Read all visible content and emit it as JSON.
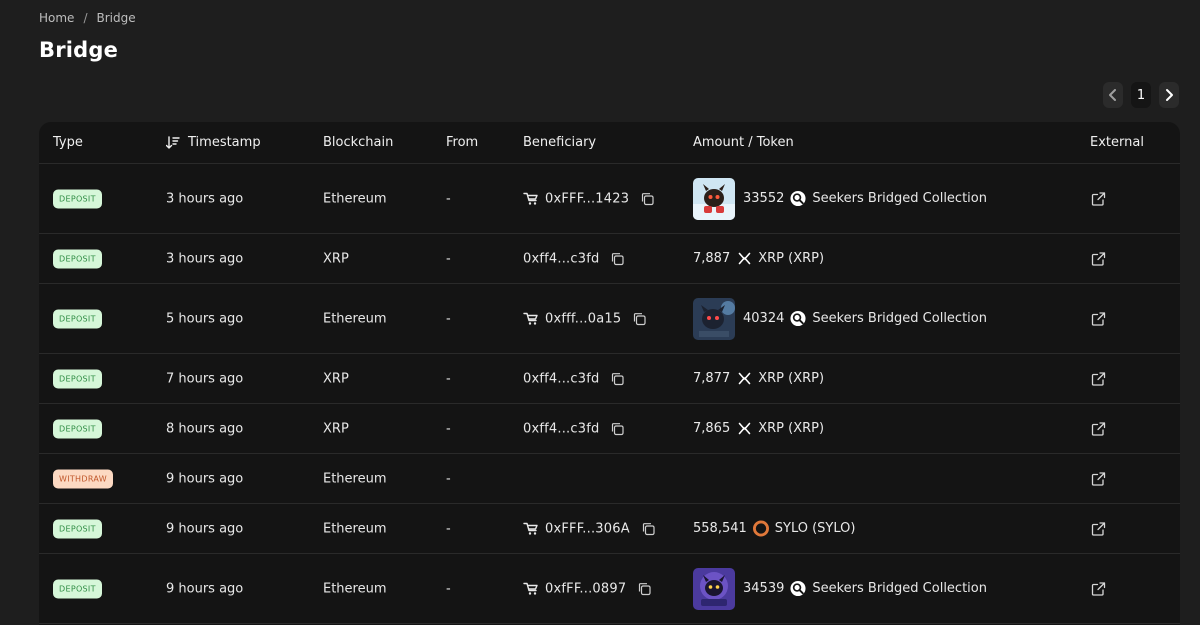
{
  "breadcrumb": {
    "home": "Home",
    "separator": "/",
    "current": "Bridge"
  },
  "page_title": "Bridge",
  "pagination": {
    "current_page": "1"
  },
  "table": {
    "headers": {
      "type": "Type",
      "timestamp": "Timestamp",
      "blockchain": "Blockchain",
      "from": "From",
      "beneficiary": "Beneficiary",
      "amount_token": "Amount / Token",
      "external": "External"
    },
    "rows": [
      {
        "type": "DEPOSIT",
        "time": "3 hours ago",
        "chain": "Ethereum",
        "from": "-",
        "beneficiary": "0xFFF...1423",
        "bridge_icon": true,
        "amount": "33552",
        "token": "Seekers Bridged Collection",
        "token_icon": "seekers-icon",
        "thumb": "nft-1"
      },
      {
        "type": "DEPOSIT",
        "time": "3 hours ago",
        "chain": "XRP",
        "from": "-",
        "beneficiary": "0xff4...c3fd",
        "bridge_icon": false,
        "amount": "7,887",
        "token": "XRP (XRP)",
        "token_icon": "xrp-icon",
        "thumb": null
      },
      {
        "type": "DEPOSIT",
        "time": "5 hours ago",
        "chain": "Ethereum",
        "from": "-",
        "beneficiary": "0xfff...0a15",
        "bridge_icon": true,
        "amount": "40324",
        "token": "Seekers Bridged Collection",
        "token_icon": "seekers-icon",
        "thumb": "nft-2"
      },
      {
        "type": "DEPOSIT",
        "time": "7 hours ago",
        "chain": "XRP",
        "from": "-",
        "beneficiary": "0xff4...c3fd",
        "bridge_icon": false,
        "amount": "7,877",
        "token": "XRP (XRP)",
        "token_icon": "xrp-icon",
        "thumb": null
      },
      {
        "type": "DEPOSIT",
        "time": "8 hours ago",
        "chain": "XRP",
        "from": "-",
        "beneficiary": "0xff4...c3fd",
        "bridge_icon": false,
        "amount": "7,865",
        "token": "XRP (XRP)",
        "token_icon": "xrp-icon",
        "thumb": null
      },
      {
        "type": "WITHDRAW",
        "time": "9 hours ago",
        "chain": "Ethereum",
        "from": "-",
        "beneficiary": "",
        "bridge_icon": false,
        "amount": "",
        "token": "",
        "token_icon": null,
        "thumb": null
      },
      {
        "type": "DEPOSIT",
        "time": "9 hours ago",
        "chain": "Ethereum",
        "from": "-",
        "beneficiary": "0xFFF...306A",
        "bridge_icon": true,
        "amount": "558,541",
        "token": "SYLO (SYLO)",
        "token_icon": "sylo-icon",
        "thumb": null
      },
      {
        "type": "DEPOSIT",
        "time": "9 hours ago",
        "chain": "Ethereum",
        "from": "-",
        "beneficiary": "0xfFF...0897",
        "bridge_icon": true,
        "amount": "34539",
        "token": "Seekers Bridged Collection",
        "token_icon": "seekers-icon",
        "thumb": "nft-3"
      }
    ]
  },
  "colors": {
    "background": "#1e1e1e",
    "table_bg": "#141414",
    "deposit_badge_bg": "#d6f7d9",
    "deposit_badge_text": "#2f8d44",
    "withdraw_badge_bg": "#fcd9c2",
    "withdraw_badge_text": "#c0572b",
    "sylo_icon": "#e0783a"
  }
}
